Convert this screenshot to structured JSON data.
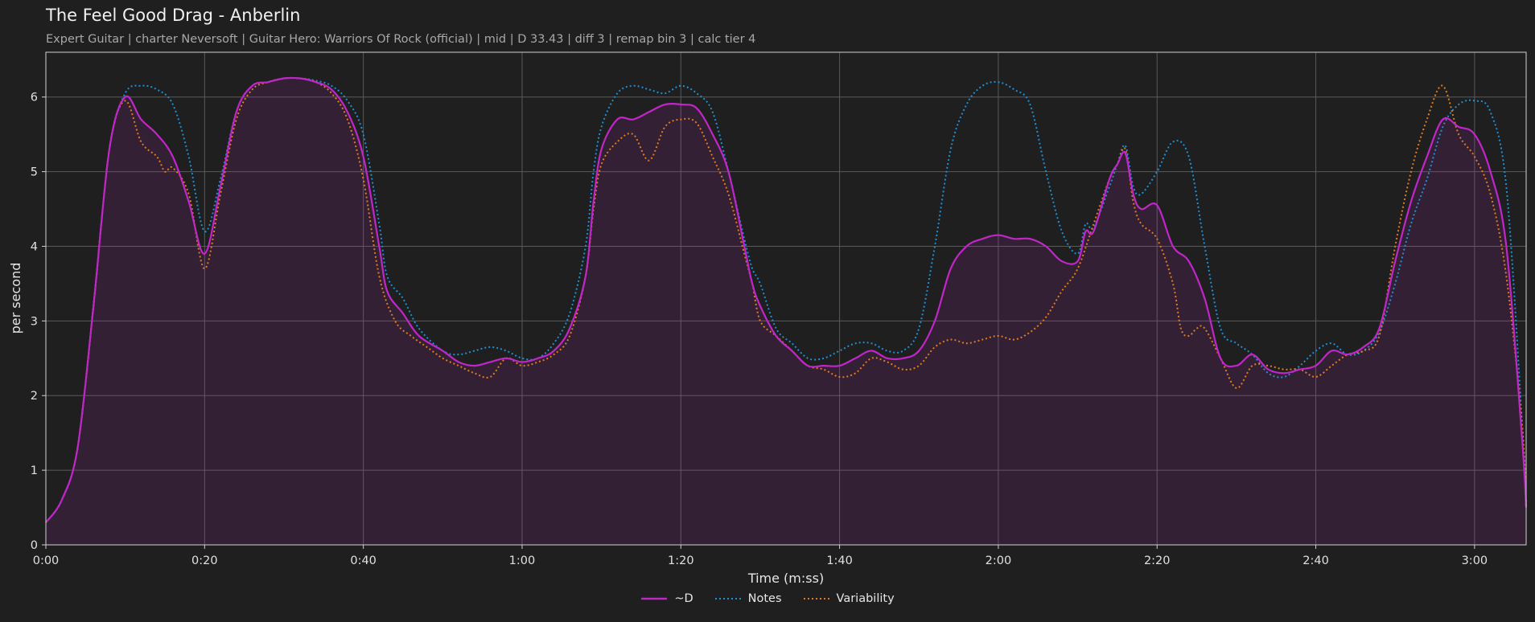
{
  "chart_data": {
    "type": "line",
    "title": "The Feel Good Drag - Anberlin",
    "subtitle": "Expert Guitar  |  charter Neversoft  |  Guitar Hero: Warriors Of Rock (official)  |  mid  |  D 33.43  |  diff 3  |  remap bin 3  |  calc tier 4",
    "xlabel": "Time (m:ss)",
    "ylabel": "per second",
    "xlim": [
      0,
      186.5
    ],
    "ylim": [
      0,
      6.6
    ],
    "x_ticks": [
      {
        "v": 0,
        "label": "0:00"
      },
      {
        "v": 20,
        "label": "0:20"
      },
      {
        "v": 40,
        "label": "0:40"
      },
      {
        "v": 60,
        "label": "1:00"
      },
      {
        "v": 80,
        "label": "1:20"
      },
      {
        "v": 100,
        "label": "1:40"
      },
      {
        "v": 120,
        "label": "2:00"
      },
      {
        "v": 140,
        "label": "2:20"
      },
      {
        "v": 160,
        "label": "2:40"
      },
      {
        "v": 180,
        "label": "3:00"
      }
    ],
    "y_ticks": [
      {
        "v": 0,
        "label": "0"
      },
      {
        "v": 1,
        "label": "1"
      },
      {
        "v": 2,
        "label": "2"
      },
      {
        "v": 3,
        "label": "3"
      },
      {
        "v": 4,
        "label": "4"
      },
      {
        "v": 5,
        "label": "5"
      },
      {
        "v": 6,
        "label": "6"
      }
    ],
    "grid": true,
    "legend_position": "bottom-center",
    "series": [
      {
        "name": "~D",
        "color": "#c026c8",
        "style": "solid",
        "fill": true,
        "points": [
          [
            0,
            0.3
          ],
          [
            2,
            0.6
          ],
          [
            4,
            1.3
          ],
          [
            6,
            3.2
          ],
          [
            8,
            5.3
          ],
          [
            10,
            6.0
          ],
          [
            12,
            5.7
          ],
          [
            14,
            5.5
          ],
          [
            16,
            5.2
          ],
          [
            18,
            4.6
          ],
          [
            20,
            3.9
          ],
          [
            22,
            4.8
          ],
          [
            24,
            5.8
          ],
          [
            26,
            6.15
          ],
          [
            28,
            6.2
          ],
          [
            30,
            6.25
          ],
          [
            32,
            6.25
          ],
          [
            34,
            6.2
          ],
          [
            36,
            6.1
          ],
          [
            38,
            5.8
          ],
          [
            40,
            5.2
          ],
          [
            42,
            4.0
          ],
          [
            43,
            3.4
          ],
          [
            45,
            3.1
          ],
          [
            47,
            2.8
          ],
          [
            50,
            2.6
          ],
          [
            52,
            2.45
          ],
          [
            54,
            2.4
          ],
          [
            56,
            2.45
          ],
          [
            58,
            2.5
          ],
          [
            60,
            2.45
          ],
          [
            62,
            2.5
          ],
          [
            64,
            2.6
          ],
          [
            66,
            2.9
          ],
          [
            68,
            3.6
          ],
          [
            69,
            4.6
          ],
          [
            70,
            5.3
          ],
          [
            72,
            5.7
          ],
          [
            74,
            5.7
          ],
          [
            76,
            5.8
          ],
          [
            78,
            5.9
          ],
          [
            80,
            5.9
          ],
          [
            82,
            5.85
          ],
          [
            84,
            5.5
          ],
          [
            86,
            5.0
          ],
          [
            88,
            4.0
          ],
          [
            89,
            3.5
          ],
          [
            90,
            3.2
          ],
          [
            92,
            2.8
          ],
          [
            94,
            2.6
          ],
          [
            96,
            2.4
          ],
          [
            98,
            2.4
          ],
          [
            100,
            2.4
          ],
          [
            102,
            2.5
          ],
          [
            104,
            2.6
          ],
          [
            106,
            2.5
          ],
          [
            108,
            2.5
          ],
          [
            110,
            2.6
          ],
          [
            112,
            3.0
          ],
          [
            114,
            3.7
          ],
          [
            116,
            4.0
          ],
          [
            118,
            4.1
          ],
          [
            120,
            4.15
          ],
          [
            122,
            4.1
          ],
          [
            124,
            4.1
          ],
          [
            126,
            4.0
          ],
          [
            128,
            3.8
          ],
          [
            130,
            3.8
          ],
          [
            131,
            4.2
          ],
          [
            132,
            4.2
          ],
          [
            134,
            4.9
          ],
          [
            135,
            5.1
          ],
          [
            136,
            5.25
          ],
          [
            137,
            4.7
          ],
          [
            138,
            4.5
          ],
          [
            140,
            4.55
          ],
          [
            142,
            4.0
          ],
          [
            144,
            3.8
          ],
          [
            146,
            3.3
          ],
          [
            148,
            2.5
          ],
          [
            150,
            2.4
          ],
          [
            152,
            2.55
          ],
          [
            154,
            2.35
          ],
          [
            156,
            2.3
          ],
          [
            158,
            2.35
          ],
          [
            160,
            2.4
          ],
          [
            162,
            2.6
          ],
          [
            164,
            2.55
          ],
          [
            166,
            2.65
          ],
          [
            168,
            2.9
          ],
          [
            170,
            3.8
          ],
          [
            172,
            4.6
          ],
          [
            174,
            5.2
          ],
          [
            176,
            5.7
          ],
          [
            178,
            5.6
          ],
          [
            180,
            5.5
          ],
          [
            182,
            5.0
          ],
          [
            184,
            4.0
          ],
          [
            186,
            1.4
          ],
          [
            186.5,
            0.5
          ]
        ]
      },
      {
        "name": "Notes",
        "color": "#1f8fd6",
        "style": "dotted",
        "fill": false,
        "points": [
          [
            0,
            0.3
          ],
          [
            2,
            0.6
          ],
          [
            4,
            1.3
          ],
          [
            6,
            3.2
          ],
          [
            8,
            5.3
          ],
          [
            10,
            6.05
          ],
          [
            12,
            6.15
          ],
          [
            14,
            6.1
          ],
          [
            16,
            5.9
          ],
          [
            18,
            5.2
          ],
          [
            20,
            4.2
          ],
          [
            22,
            4.9
          ],
          [
            24,
            5.8
          ],
          [
            26,
            6.15
          ],
          [
            28,
            6.2
          ],
          [
            30,
            6.25
          ],
          [
            32,
            6.25
          ],
          [
            34,
            6.22
          ],
          [
            36,
            6.15
          ],
          [
            38,
            5.95
          ],
          [
            40,
            5.5
          ],
          [
            42,
            4.3
          ],
          [
            43,
            3.6
          ],
          [
            45,
            3.3
          ],
          [
            47,
            2.9
          ],
          [
            50,
            2.6
          ],
          [
            52,
            2.55
          ],
          [
            54,
            2.6
          ],
          [
            56,
            2.65
          ],
          [
            58,
            2.6
          ],
          [
            60,
            2.5
          ],
          [
            62,
            2.5
          ],
          [
            64,
            2.7
          ],
          [
            66,
            3.1
          ],
          [
            68,
            4.0
          ],
          [
            69,
            5.0
          ],
          [
            70,
            5.6
          ],
          [
            72,
            6.05
          ],
          [
            74,
            6.15
          ],
          [
            76,
            6.1
          ],
          [
            78,
            6.05
          ],
          [
            80,
            6.15
          ],
          [
            82,
            6.05
          ],
          [
            84,
            5.8
          ],
          [
            86,
            5.0
          ],
          [
            88,
            4.1
          ],
          [
            89,
            3.7
          ],
          [
            90,
            3.5
          ],
          [
            92,
            2.9
          ],
          [
            94,
            2.7
          ],
          [
            96,
            2.5
          ],
          [
            98,
            2.5
          ],
          [
            100,
            2.6
          ],
          [
            102,
            2.7
          ],
          [
            104,
            2.7
          ],
          [
            106,
            2.6
          ],
          [
            108,
            2.6
          ],
          [
            110,
            2.9
          ],
          [
            112,
            4.0
          ],
          [
            114,
            5.3
          ],
          [
            116,
            5.9
          ],
          [
            118,
            6.15
          ],
          [
            120,
            6.2
          ],
          [
            122,
            6.1
          ],
          [
            124,
            5.9
          ],
          [
            126,
            5.0
          ],
          [
            128,
            4.2
          ],
          [
            130,
            3.9
          ],
          [
            131,
            4.3
          ],
          [
            132,
            4.25
          ],
          [
            134,
            4.8
          ],
          [
            135,
            5.1
          ],
          [
            136,
            5.35
          ],
          [
            137,
            4.8
          ],
          [
            138,
            4.7
          ],
          [
            140,
            5.0
          ],
          [
            142,
            5.4
          ],
          [
            144,
            5.2
          ],
          [
            146,
            4.0
          ],
          [
            148,
            2.9
          ],
          [
            150,
            2.7
          ],
          [
            152,
            2.55
          ],
          [
            154,
            2.3
          ],
          [
            156,
            2.25
          ],
          [
            158,
            2.4
          ],
          [
            160,
            2.6
          ],
          [
            162,
            2.7
          ],
          [
            164,
            2.55
          ],
          [
            166,
            2.6
          ],
          [
            168,
            2.85
          ],
          [
            170,
            3.5
          ],
          [
            172,
            4.3
          ],
          [
            174,
            4.9
          ],
          [
            176,
            5.6
          ],
          [
            178,
            5.9
          ],
          [
            180,
            5.95
          ],
          [
            182,
            5.8
          ],
          [
            184,
            4.8
          ],
          [
            186,
            1.6
          ],
          [
            186.5,
            0.5
          ]
        ]
      },
      {
        "name": "Variability",
        "color": "#e07b1f",
        "style": "dotted",
        "fill": false,
        "points": [
          [
            0,
            0.3
          ],
          [
            2,
            0.6
          ],
          [
            4,
            1.3
          ],
          [
            6,
            3.2
          ],
          [
            8,
            5.3
          ],
          [
            10,
            5.95
          ],
          [
            12,
            5.4
          ],
          [
            14,
            5.2
          ],
          [
            15,
            5.0
          ],
          [
            16,
            5.05
          ],
          [
            18,
            4.7
          ],
          [
            20,
            3.7
          ],
          [
            22,
            4.7
          ],
          [
            24,
            5.7
          ],
          [
            26,
            6.1
          ],
          [
            28,
            6.2
          ],
          [
            30,
            6.25
          ],
          [
            32,
            6.25
          ],
          [
            34,
            6.2
          ],
          [
            36,
            6.05
          ],
          [
            38,
            5.7
          ],
          [
            40,
            4.9
          ],
          [
            42,
            3.6
          ],
          [
            44,
            3.0
          ],
          [
            46,
            2.8
          ],
          [
            48,
            2.65
          ],
          [
            50,
            2.5
          ],
          [
            52,
            2.4
          ],
          [
            54,
            2.3
          ],
          [
            56,
            2.25
          ],
          [
            58,
            2.5
          ],
          [
            60,
            2.4
          ],
          [
            62,
            2.45
          ],
          [
            64,
            2.55
          ],
          [
            66,
            2.8
          ],
          [
            68,
            3.6
          ],
          [
            69,
            4.5
          ],
          [
            70,
            5.1
          ],
          [
            72,
            5.4
          ],
          [
            74,
            5.5
          ],
          [
            76,
            5.15
          ],
          [
            78,
            5.6
          ],
          [
            80,
            5.7
          ],
          [
            82,
            5.65
          ],
          [
            84,
            5.2
          ],
          [
            86,
            4.7
          ],
          [
            88,
            3.9
          ],
          [
            89,
            3.5
          ],
          [
            90,
            3.0
          ],
          [
            92,
            2.8
          ],
          [
            94,
            2.6
          ],
          [
            96,
            2.4
          ],
          [
            98,
            2.35
          ],
          [
            100,
            2.25
          ],
          [
            102,
            2.3
          ],
          [
            104,
            2.5
          ],
          [
            106,
            2.45
          ],
          [
            108,
            2.35
          ],
          [
            110,
            2.4
          ],
          [
            112,
            2.65
          ],
          [
            114,
            2.75
          ],
          [
            116,
            2.7
          ],
          [
            118,
            2.75
          ],
          [
            120,
            2.8
          ],
          [
            122,
            2.75
          ],
          [
            124,
            2.85
          ],
          [
            126,
            3.05
          ],
          [
            128,
            3.4
          ],
          [
            130,
            3.7
          ],
          [
            132,
            4.3
          ],
          [
            134,
            4.9
          ],
          [
            135,
            5.1
          ],
          [
            136,
            5.3
          ],
          [
            137,
            4.6
          ],
          [
            138,
            4.3
          ],
          [
            140,
            4.1
          ],
          [
            142,
            3.5
          ],
          [
            143,
            2.9
          ],
          [
            144,
            2.8
          ],
          [
            145,
            2.9
          ],
          [
            146,
            2.9
          ],
          [
            148,
            2.5
          ],
          [
            150,
            2.1
          ],
          [
            152,
            2.4
          ],
          [
            154,
            2.4
          ],
          [
            156,
            2.35
          ],
          [
            158,
            2.35
          ],
          [
            160,
            2.25
          ],
          [
            162,
            2.4
          ],
          [
            164,
            2.55
          ],
          [
            166,
            2.6
          ],
          [
            168,
            2.8
          ],
          [
            170,
            4.0
          ],
          [
            172,
            5.0
          ],
          [
            174,
            5.7
          ],
          [
            176,
            6.15
          ],
          [
            178,
            5.5
          ],
          [
            180,
            5.2
          ],
          [
            182,
            4.7
          ],
          [
            184,
            3.6
          ],
          [
            186,
            1.6
          ],
          [
            186.5,
            0.5
          ]
        ]
      }
    ]
  }
}
